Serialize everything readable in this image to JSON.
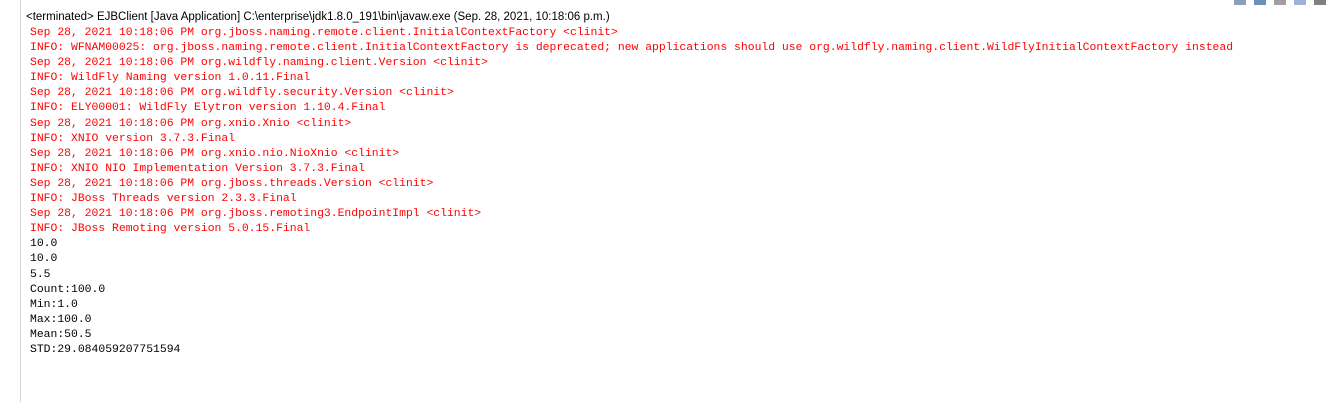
{
  "console": {
    "header": "<terminated> EJBClient [Java Application] C:\\enterprise\\jdk1.8.0_191\\bin\\javaw.exe (Sep. 28, 2021, 10:18:06 p.m.)",
    "lines": [
      {
        "text": "Sep 28, 2021 10:18:06 PM org.jboss.naming.remote.client.InitialContextFactory <clinit>",
        "stream": "err"
      },
      {
        "text": "INFO: WFNAM00025: org.jboss.naming.remote.client.InitialContextFactory is deprecated; new applications should use org.wildfly.naming.client.WildFlyInitialContextFactory instead",
        "stream": "err"
      },
      {
        "text": "Sep 28, 2021 10:18:06 PM org.wildfly.naming.client.Version <clinit>",
        "stream": "err"
      },
      {
        "text": "INFO: WildFly Naming version 1.0.11.Final",
        "stream": "err"
      },
      {
        "text": "Sep 28, 2021 10:18:06 PM org.wildfly.security.Version <clinit>",
        "stream": "err"
      },
      {
        "text": "INFO: ELY00001: WildFly Elytron version 1.10.4.Final",
        "stream": "err"
      },
      {
        "text": "Sep 28, 2021 10:18:06 PM org.xnio.Xnio <clinit>",
        "stream": "err"
      },
      {
        "text": "INFO: XNIO version 3.7.3.Final",
        "stream": "err"
      },
      {
        "text": "Sep 28, 2021 10:18:06 PM org.xnio.nio.NioXnio <clinit>",
        "stream": "err"
      },
      {
        "text": "INFO: XNIO NIO Implementation Version 3.7.3.Final",
        "stream": "err"
      },
      {
        "text": "Sep 28, 2021 10:18:06 PM org.jboss.threads.Version <clinit>",
        "stream": "err"
      },
      {
        "text": "INFO: JBoss Threads version 2.3.3.Final",
        "stream": "err"
      },
      {
        "text": "Sep 28, 2021 10:18:06 PM org.jboss.remoting3.EndpointImpl <clinit>",
        "stream": "err"
      },
      {
        "text": "INFO: JBoss Remoting version 5.0.15.Final",
        "stream": "err"
      },
      {
        "text": "10.0",
        "stream": "out"
      },
      {
        "text": "10.0",
        "stream": "out"
      },
      {
        "text": "5.5",
        "stream": "out"
      },
      {
        "text": "Count:100.0",
        "stream": "out"
      },
      {
        "text": "Min:1.0",
        "stream": "out"
      },
      {
        "text": "Max:100.0",
        "stream": "out"
      },
      {
        "text": "Mean:50.5",
        "stream": "out"
      },
      {
        "text": "STD:29.084059207751594",
        "stream": "out"
      }
    ]
  },
  "colors": {
    "stderr": "#ff0000",
    "stdout": "#000000",
    "background": "#ffffff"
  }
}
